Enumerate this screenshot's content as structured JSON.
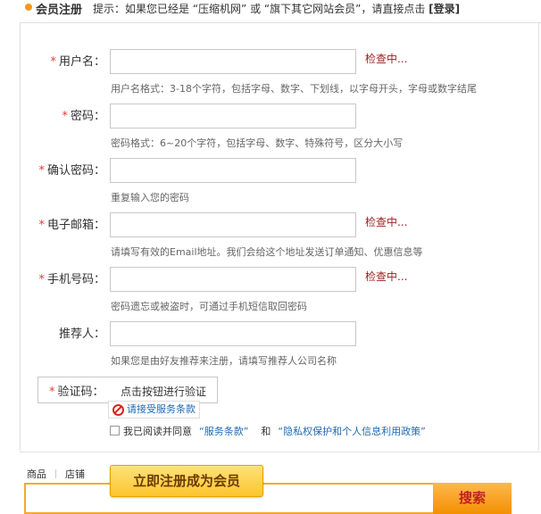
{
  "header": {
    "title": "会员注册",
    "tip_prefix": "提示：如果您已经是 “压缩机网” 或 “旗下其它网站会员”，请直接点击",
    "login_link": "[登录]"
  },
  "form": {
    "required_mark": "*",
    "checking_text": "检查中...",
    "fields": [
      {
        "label": "用户名：",
        "required": true,
        "value": "",
        "status": "检查中...",
        "hint": "用户名格式：3-18个字符，包括字母、数字、下划线，以字母开头，字母或数字结尾"
      },
      {
        "label": "密码：",
        "required": true,
        "value": "",
        "status": "",
        "hint": "密码格式：6~20个字符，包括字母、数字、特殊符号，区分大小写"
      },
      {
        "label": "确认密码：",
        "required": true,
        "value": "",
        "status": "",
        "hint": "重复输入您的密码"
      },
      {
        "label": "电子邮箱：",
        "required": true,
        "value": "",
        "status": "检查中...",
        "hint": "请填写有效的Email地址。我们会给这个地址发送订单通知、优惠信息等"
      },
      {
        "label": "手机号码：",
        "required": true,
        "value": "",
        "status": "检查中...",
        "hint": "密码遗忘或被盗时，可通过手机短信取回密码"
      },
      {
        "label": "推荐人：",
        "required": false,
        "value": "",
        "status": "",
        "hint": "如果您是由好友推荐来注册，请填写推荐人公司名称"
      }
    ],
    "captcha": {
      "label": "验证码：",
      "button": "点击按钮进行验证"
    },
    "terms_warning": "请接受服务条款",
    "agree": {
      "text": "我已阅读并同意",
      "service_terms": "“服务条款”",
      "and": "和",
      "privacy_policy": "“隐私权保护和个人信息利用政策”"
    }
  },
  "register_button": "立即注册成为会员",
  "search": {
    "tabs": [
      "商品",
      "店铺"
    ],
    "button": "搜索",
    "value": ""
  },
  "colors": {
    "accent": "#f39a1e",
    "required": "#e4393c",
    "checking": "#9b1d1d",
    "link": "#1d6ab3"
  }
}
